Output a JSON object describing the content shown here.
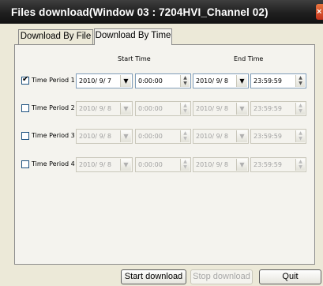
{
  "window": {
    "title": "Files download(Window 03 : 7204HVI_Channel 02)",
    "close_glyph": "×"
  },
  "tabs": [
    {
      "label": "Download By File",
      "active": false
    },
    {
      "label": "Download By Time",
      "active": true
    }
  ],
  "headers": {
    "start": "Start Time",
    "end": "End Time"
  },
  "periods": [
    {
      "label": "Time Period 1",
      "checked": true,
      "check_glyph": "✔",
      "start_date": "2010/ 9/ 7",
      "start_time": "0:00:00",
      "end_date": "2010/ 9/ 8",
      "end_time": "23:59:59"
    },
    {
      "label": "Time Period 2",
      "checked": false,
      "check_glyph": "",
      "start_date": "2010/ 9/ 8",
      "start_time": "0:00:00",
      "end_date": "2010/ 9/ 8",
      "end_time": "23:59:59"
    },
    {
      "label": "Time Period 3",
      "checked": false,
      "check_glyph": "",
      "start_date": "2010/ 9/ 8",
      "start_time": "0:00:00",
      "end_date": "2010/ 9/ 8",
      "end_time": "23:59:59"
    },
    {
      "label": "Time Period 4",
      "checked": false,
      "check_glyph": "",
      "start_date": "2010/ 9/ 8",
      "start_time": "0:00:00",
      "end_date": "2010/ 9/ 8",
      "end_time": "23:59:59"
    }
  ],
  "glyphs": {
    "dropdown": "▼",
    "spin_up": "▲",
    "spin_down": "▼"
  },
  "buttons": {
    "start_download": "Start download",
    "stop_download": "Stop download",
    "quit": "Quit"
  },
  "colors": {
    "titlebar": "#1f1f1f",
    "close": "#d6452a",
    "window_bg": "#ece9d8",
    "panel_bg": "#f4f3ee",
    "field_border": "#7f9db9"
  }
}
